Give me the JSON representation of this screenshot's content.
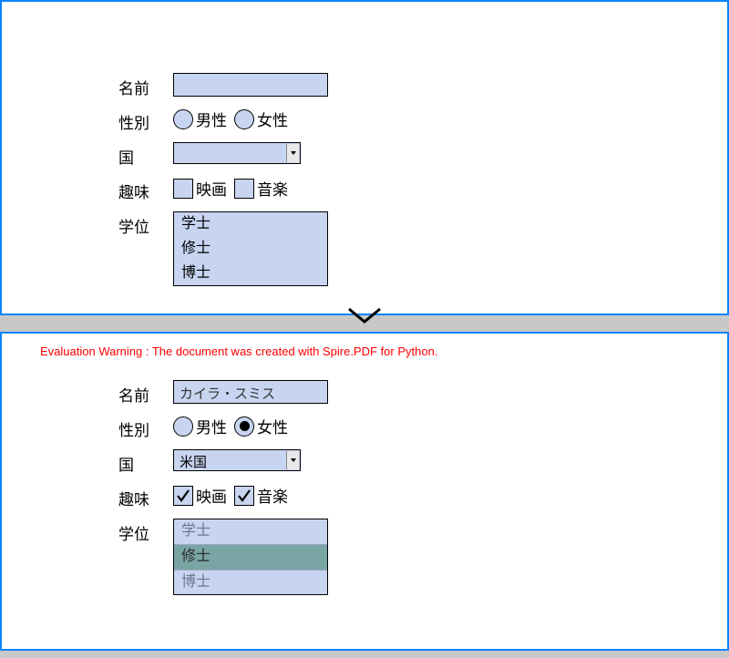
{
  "top": {
    "labels": {
      "name": "名前",
      "gender": "性別",
      "country": "国",
      "hobby": "趣味",
      "degree": "学位"
    },
    "name_value": "",
    "gender": {
      "male": "男性",
      "female": "女性"
    },
    "country_value": "",
    "hobby": {
      "movie": "映画",
      "music": "音楽"
    },
    "degrees": {
      "bachelor": "学士",
      "master": "修士",
      "doctor": "博士"
    }
  },
  "warning": "Evaluation Warning : The document was created with Spire.PDF for Python.",
  "bottom": {
    "labels": {
      "name": "名前",
      "gender": "性別",
      "country": "国",
      "hobby": "趣味",
      "degree": "学位"
    },
    "name_value": "カイラ・スミス",
    "gender": {
      "male": "男性",
      "female": "女性"
    },
    "country_value": "米国",
    "hobby": {
      "movie": "映画",
      "music": "音楽"
    },
    "degrees": {
      "bachelor": "学士",
      "master": "修士",
      "doctor": "博士"
    }
  }
}
